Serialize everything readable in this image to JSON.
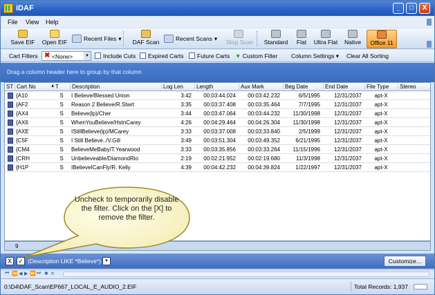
{
  "window": {
    "title": "iDAF",
    "controls": [
      "_",
      "□",
      "X"
    ]
  },
  "menu": [
    "File",
    "View",
    "Help"
  ],
  "toolbar": {
    "save_eif": "Save EIF",
    "open_eif": "Open EIF",
    "recent_files": "Recent Files",
    "daf_scan": "DAF Scan",
    "recent_scans": "Recent Scans",
    "stop_scan": "Stop Scan",
    "standard": "Standard",
    "flat": "Flat",
    "ultra_flat": "Ultra Flat",
    "native": "Native",
    "office11": "Office 11",
    "colors": {
      "active": "#f59b2b"
    }
  },
  "filterbar": {
    "cart_filters": "Cart Filters",
    "none_value": "<None>",
    "include_cuts": "Include Cuts",
    "expired_carts": "Expired Carts",
    "future_carts": "Future Carts",
    "custom_filter": "Custom Filter",
    "column_settings": "Column Settings",
    "clear_all_sorting": "Clear All Sorting"
  },
  "group_hint": "Drag a column header here to group by that column",
  "grid": {
    "columns": [
      "ST",
      "Cart No",
      "T",
      "Description",
      "Log Len",
      "Length",
      "Aux Mark",
      "Beg Date",
      "End Date",
      "File Type",
      "Stereo"
    ],
    "rows": [
      {
        "cart": "{A10",
        "t": "S",
        "desc": "I Believe/Blessed Union",
        "log_len": "3:42",
        "length": "00:03:44.024",
        "aux": "00:03:42.232",
        "beg": "6/5/1995",
        "end": "12/31/2037",
        "ftype": "apt-X",
        "stereo": true
      },
      {
        "cart": "{AF2",
        "t": "S",
        "desc": "Reason 2 Believe/R.Stwrt",
        "log_len": "3:35",
        "length": "00:03:37.408",
        "aux": "00:03:35.464",
        "beg": "7/7/1995",
        "end": "12/31/2037",
        "ftype": "apt-X",
        "stereo": true
      },
      {
        "cart": "{AX4",
        "t": "S",
        "desc": "Believe(lp)/Cher",
        "log_len": "3:44",
        "length": "00:03:47.064",
        "aux": "00:03:44.232",
        "beg": "11/30/1998",
        "end": "12/31/2037",
        "ftype": "apt-X",
        "stereo": true
      },
      {
        "cart": "{AX6",
        "t": "S",
        "desc": "WhenYouBelieve/HstnCarey",
        "log_len": "4:26",
        "length": "00:04:29.464",
        "aux": "00:04:26.304",
        "beg": "11/30/1998",
        "end": "12/31/2037",
        "ftype": "apt-X",
        "stereo": true
      },
      {
        "cart": "{AXE",
        "t": "S",
        "desc": "IStillBelieve(lp)/MCarey",
        "log_len": "3:33",
        "length": "00:03:37.008",
        "aux": "00:03:33.840",
        "beg": "2/5/1999",
        "end": "12/31/2037",
        "ftype": "apt-X",
        "stereo": true
      },
      {
        "cart": "{C5F",
        "t": "S",
        "desc": "I Still Believe../V.Gill",
        "log_len": "3:49",
        "length": "00:03:51.304",
        "aux": "00:03:49.352",
        "beg": "6/21/1995",
        "end": "12/31/2037",
        "ftype": "apt-X",
        "stereo": true
      },
      {
        "cart": "{CM4",
        "t": "S",
        "desc": "BelieveMeBaby/T.Yearwood",
        "log_len": "3:33",
        "length": "00:03:35.856",
        "aux": "00:03:33.264",
        "beg": "11/15/1996",
        "end": "12/31/2037",
        "ftype": "apt-X",
        "stereo": true
      },
      {
        "cart": "{CRH",
        "t": "S",
        "desc": "Unbelieveable/DiamondRio",
        "log_len": "2:19",
        "length": "00:02:21.952",
        "aux": "00:02:19.680",
        "beg": "11/3/1998",
        "end": "12/31/2037",
        "ftype": "apt-X",
        "stereo": true
      },
      {
        "cart": "{H1P",
        "t": "S",
        "desc": "IBelieveICanFly/R. Kelly",
        "log_len": "4:39",
        "length": "00:04:42.232",
        "aux": "00:04:39.824",
        "beg": "1/22/1997",
        "end": "12/31/2037",
        "ftype": "apt-X",
        "stereo": true
      }
    ],
    "footer_count": "9"
  },
  "filter_panel": {
    "close_glyph": "X",
    "check_glyph": "✓",
    "expression": "(Description LIKE *Believe*)",
    "customize": "Customize..."
  },
  "callout": "Uncheck to temporarily disable the filter. Click on the [X] to remove the filter.",
  "statusbar": {
    "path": "0:\\D4\\DAF_Scan\\EP667_LOCAL_E_AUDIO_2.EIF",
    "total_records": "Total Records: 1,937"
  }
}
